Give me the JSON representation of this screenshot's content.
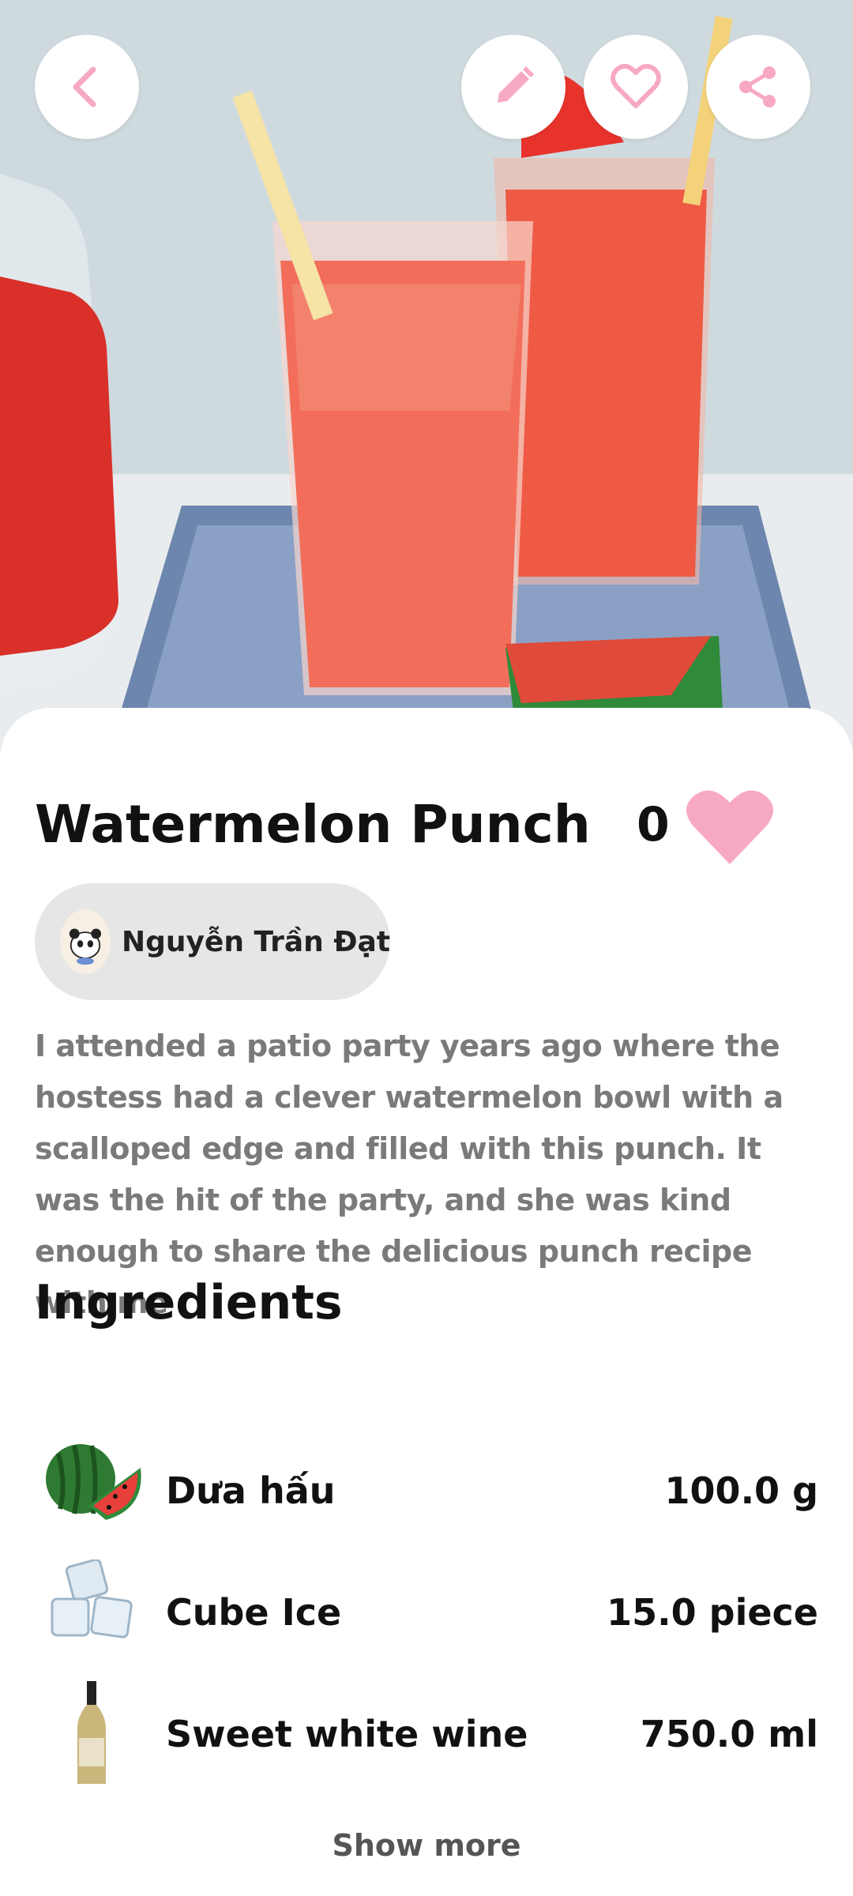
{
  "recipe": {
    "title": "Watermelon Punch",
    "like_count": "0",
    "author": "Nguyễn Trần Đạt",
    "description": "I attended a patio party years ago where the hostess had a clever watermelon bowl with a scalloped edge and filled with this punch. It was the hit of the party, and she was kind enough to share the delicious punch recipe with me"
  },
  "toolbar": {
    "back_icon": "chevron-left-icon",
    "edit_icon": "pencil-icon",
    "favorite_icon": "heart-outline-icon",
    "share_icon": "share-icon",
    "accent_color": "#f7a8c4"
  },
  "ingredients": {
    "section_title": "Ingredients",
    "items": [
      {
        "name": "Dưa hấu",
        "quantity": "100.0 g",
        "icon": "watermelon-image"
      },
      {
        "name": "Cube Ice",
        "quantity": "15.0 piece",
        "icon": "ice-cube-image"
      },
      {
        "name": "Sweet white wine",
        "quantity": "750.0 ml",
        "icon": "wine-bottle-image"
      }
    ],
    "show_more_label": "Show more"
  }
}
